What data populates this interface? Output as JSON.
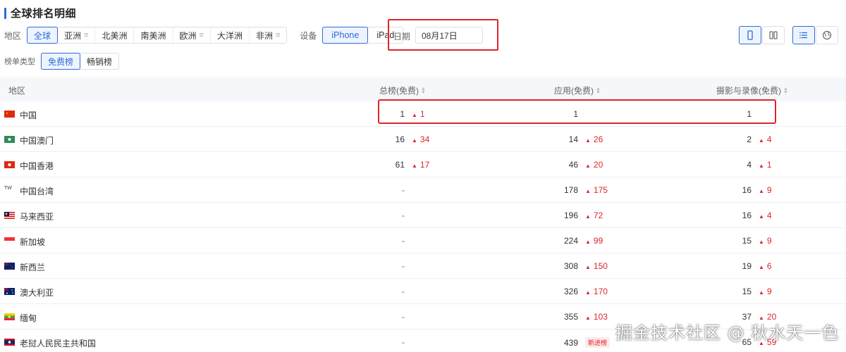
{
  "header": {
    "title": "全球排名明细"
  },
  "filters": {
    "region_label": "地区",
    "regions": [
      {
        "label": "全球",
        "active": true,
        "menu": false
      },
      {
        "label": "亚洲",
        "active": false,
        "menu": true
      },
      {
        "label": "北美洲",
        "active": false,
        "menu": false
      },
      {
        "label": "南美洲",
        "active": false,
        "menu": false
      },
      {
        "label": "欧洲",
        "active": false,
        "menu": true
      },
      {
        "label": "大洋洲",
        "active": false,
        "menu": false
      },
      {
        "label": "非洲",
        "active": false,
        "menu": true
      }
    ],
    "device_label": "设备",
    "devices": [
      {
        "label": "iPhone",
        "active": true
      },
      {
        "label": "iPad",
        "active": false
      }
    ],
    "date_label": "日期",
    "date_value": "08月17日",
    "list_type_label": "榜单类型",
    "list_types": [
      {
        "label": "免费榜",
        "active": true
      },
      {
        "label": "畅销榜",
        "active": false
      }
    ]
  },
  "toolbar": {
    "icons": [
      "phone-icon",
      "columns-icon",
      "list-icon",
      "globe-icon"
    ]
  },
  "table": {
    "columns": [
      "地区",
      "总榜(免费)",
      "应用(免费)",
      "摄影与录像(免费)"
    ],
    "rows": [
      {
        "region": "中国",
        "flag": "cn",
        "total": "1",
        "total_chg": "1",
        "app": "1",
        "app_chg": "",
        "photo": "1",
        "photo_chg": ""
      },
      {
        "region": "中国澳门",
        "flag": "mo",
        "total": "16",
        "total_chg": "34",
        "app": "14",
        "app_chg": "26",
        "photo": "2",
        "photo_chg": "4"
      },
      {
        "region": "中国香港",
        "flag": "hk",
        "total": "61",
        "total_chg": "17",
        "app": "46",
        "app_chg": "20",
        "photo": "4",
        "photo_chg": "1"
      },
      {
        "region": "中国台湾",
        "flag": "tw",
        "total": "-",
        "total_chg": "",
        "app": "178",
        "app_chg": "175",
        "photo": "16",
        "photo_chg": "9"
      },
      {
        "region": "马来西亚",
        "flag": "my",
        "total": "-",
        "total_chg": "",
        "app": "196",
        "app_chg": "72",
        "photo": "16",
        "photo_chg": "4"
      },
      {
        "region": "新加坡",
        "flag": "sg",
        "total": "-",
        "total_chg": "",
        "app": "224",
        "app_chg": "99",
        "photo": "15",
        "photo_chg": "9"
      },
      {
        "region": "新西兰",
        "flag": "nz",
        "total": "-",
        "total_chg": "",
        "app": "308",
        "app_chg": "150",
        "photo": "19",
        "photo_chg": "6"
      },
      {
        "region": "澳大利亚",
        "flag": "au",
        "total": "-",
        "total_chg": "",
        "app": "326",
        "app_chg": "170",
        "photo": "15",
        "photo_chg": "9"
      },
      {
        "region": "缅甸",
        "flag": "mm",
        "total": "-",
        "total_chg": "",
        "app": "355",
        "app_chg": "103",
        "photo": "37",
        "photo_chg": "20"
      },
      {
        "region": "老挝人民民主共和国",
        "flag": "la",
        "total": "-",
        "total_chg": "",
        "app": "439",
        "app_chg": "",
        "app_tag": "新进榜",
        "photo": "65",
        "photo_chg": "59"
      }
    ]
  },
  "flag_label_tw": "TW",
  "watermark": "掘金技术社区 @ 秋水天一色",
  "colors": {
    "accent": "#2f6bd6",
    "rise": "#e0242b",
    "highlight_box": "#e0242b"
  }
}
